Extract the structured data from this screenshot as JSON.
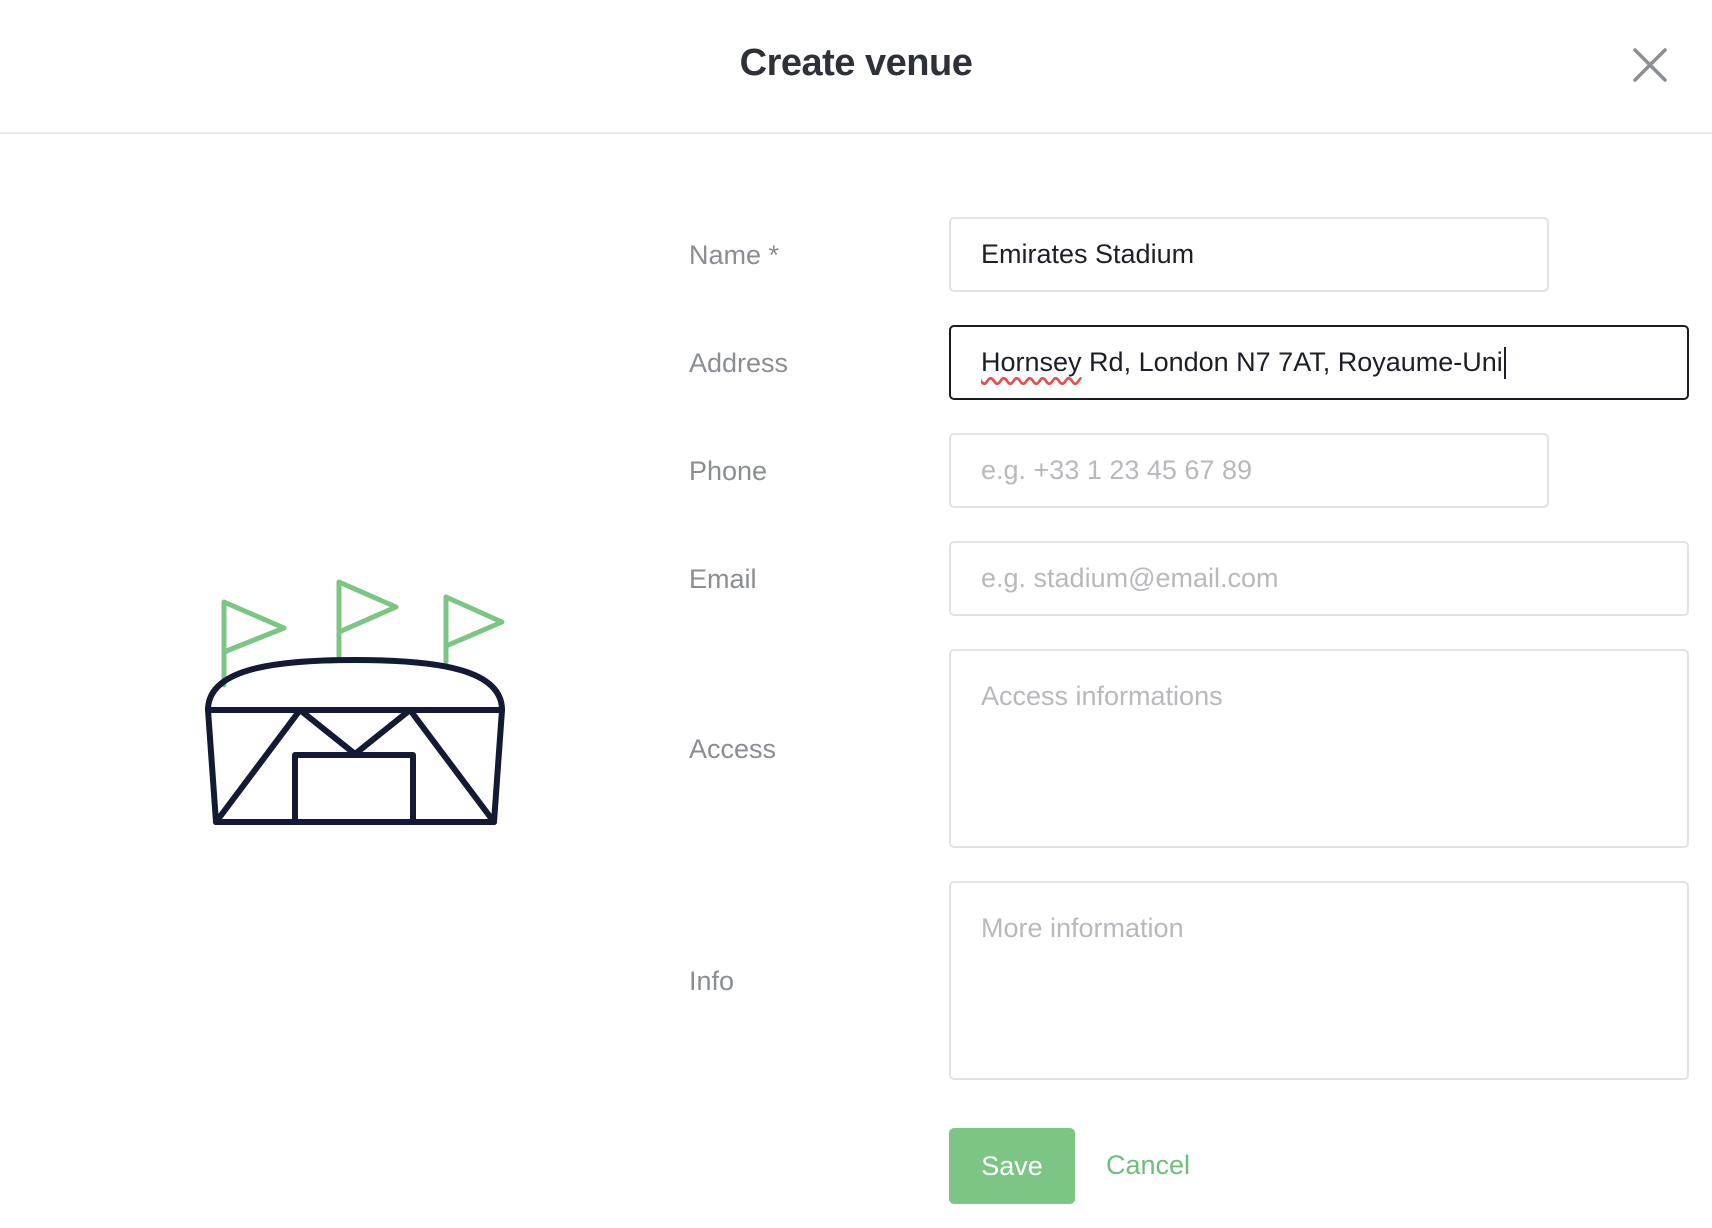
{
  "header": {
    "title": "Create venue"
  },
  "form": {
    "name": {
      "label": "Name *",
      "value": "Emirates Stadium",
      "placeholder": ""
    },
    "address": {
      "label": "Address",
      "value": "Hornsey Rd, London N7 7AT, Royaume-Uni",
      "placeholder": ""
    },
    "phone": {
      "label": "Phone",
      "value": "",
      "placeholder": "e.g. +33 1 23 45 67 89"
    },
    "email": {
      "label": "Email",
      "value": "",
      "placeholder": "e.g. stadium@email.com"
    },
    "access": {
      "label": "Access",
      "value": "",
      "placeholder": "Access informations"
    },
    "info": {
      "label": "Info",
      "value": "",
      "placeholder": "More information"
    }
  },
  "actions": {
    "save_label": "Save",
    "cancel_label": "Cancel"
  },
  "colors": {
    "accent": "#7cc584",
    "illustration_dark": "#141a33",
    "illustration_flag": "#7cc584"
  },
  "icons": {
    "close": "close-icon",
    "illustration": "stadium-illustration-icon"
  }
}
